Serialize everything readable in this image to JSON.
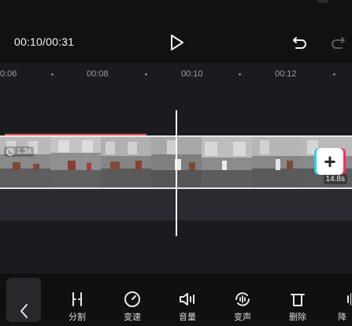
{
  "header": {
    "time": "00:10/00:31",
    "play_icon": "play-icon",
    "undo_icon": "undo-icon",
    "redo_icon": "redo-icon"
  },
  "ruler": {
    "ticks": [
      "0:06",
      "00:08",
      "00:10",
      "00:12"
    ]
  },
  "clip": {
    "speed": "1.3x",
    "duration": "14.8s"
  },
  "add_clip": {
    "icon": "plus-icon"
  },
  "toolbar": {
    "back_icon": "chevron-left-icon",
    "tools": [
      {
        "label": "分割",
        "icon": "split-icon"
      },
      {
        "label": "变速",
        "icon": "speed-icon"
      },
      {
        "label": "音量",
        "icon": "volume-icon"
      },
      {
        "label": "变声",
        "icon": "voice-change-icon"
      },
      {
        "label": "删除",
        "icon": "delete-icon"
      },
      {
        "label": "降",
        "icon": "noise-reduction-icon"
      }
    ]
  },
  "colors": {
    "background": "#111114",
    "track": "#1b1b1f",
    "accent_red": "#e2605e",
    "accent_cyan": "#2bd4e0",
    "accent_pink": "#ff2d55"
  }
}
